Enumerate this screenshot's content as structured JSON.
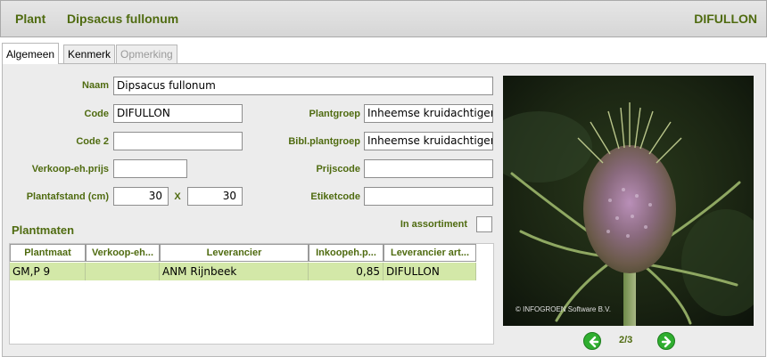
{
  "header": {
    "section_label": "Plant",
    "plant_name": "Dipsacus fullonum",
    "code": "DIFULLON"
  },
  "tabs": [
    {
      "label": "Algemeen",
      "state": "active"
    },
    {
      "label": "Kenmerk",
      "state": "normal"
    },
    {
      "label": "Opmerking",
      "state": "disabled"
    }
  ],
  "form": {
    "naam": {
      "label": "Naam",
      "value": "Dipsacus fullonum"
    },
    "code": {
      "label": "Code",
      "value": "DIFULLON"
    },
    "code2": {
      "label": "Code 2",
      "value": ""
    },
    "verkoop": {
      "label": "Verkoop-eh.prijs",
      "value": ""
    },
    "plantafstand": {
      "label": "Plantafstand (cm)",
      "value1": "30",
      "separator": "X",
      "value2": "30"
    },
    "plantgroep": {
      "label": "Plantgroep",
      "value": "Inheemse kruidachtiger"
    },
    "bibl": {
      "label": "Bibl.plantgroep",
      "value": "Inheemse kruidachtiger"
    },
    "prijscode": {
      "label": "Prijscode",
      "value": ""
    },
    "etiketcode": {
      "label": "Etiketcode",
      "value": ""
    },
    "assortiment": {
      "label": "In assortiment",
      "checked": false
    }
  },
  "plantmaten": {
    "title": "Plantmaten",
    "columns": [
      "Plantmaat",
      "Verkoop-eh...",
      "Leverancier",
      "Inkoopeh.p...",
      "Leverancier art..."
    ],
    "rows": [
      [
        "GM,P 9",
        "",
        "ANM Rijnbeek",
        "0,85",
        "DIFULLON"
      ]
    ]
  },
  "photo": {
    "copyright": "© INFOGROEN Software B.V.",
    "page_indicator": "2/3",
    "prev_icon": "arrow-left-circle-icon",
    "next_icon": "arrow-right-circle-icon"
  },
  "colors": {
    "label_green": "#4f6b10",
    "row_highlight": "#d3e8a8",
    "nav_green": "#2fae2f"
  }
}
